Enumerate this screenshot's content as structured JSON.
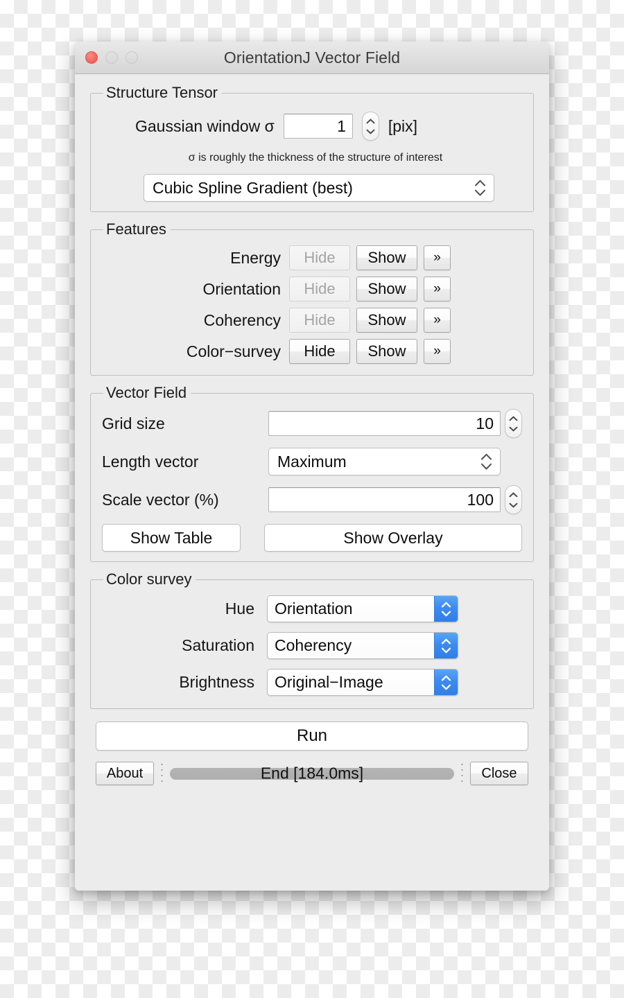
{
  "window": {
    "title": "OrientationJ Vector Field",
    "traffic_lights": [
      "close-light",
      "minimize-light",
      "zoom-light"
    ]
  },
  "structure_tensor": {
    "legend": "Structure Tensor",
    "gaussian_label": "Gaussian window σ",
    "gaussian_value": "1",
    "gaussian_unit": "[pix]",
    "hint": "σ is roughly the thickness of the structure of interest",
    "gradient_selected": "Cubic Spline Gradient (best)"
  },
  "features": {
    "legend": "Features",
    "hide_label": "Hide",
    "show_label": "Show",
    "more_label": "»",
    "rows": [
      {
        "label": "Energy",
        "hide_enabled": false
      },
      {
        "label": "Orientation",
        "hide_enabled": false
      },
      {
        "label": "Coherency",
        "hide_enabled": false
      },
      {
        "label": "Color−survey",
        "hide_enabled": true
      }
    ]
  },
  "vector_field": {
    "legend": "Vector Field",
    "grid_size_label": "Grid size",
    "grid_size_value": "10",
    "length_vector_label": "Length vector",
    "length_vector_selected": "Maximum",
    "scale_vector_label": "Scale vector (%)",
    "scale_vector_value": "100",
    "show_table_label": "Show Table",
    "show_overlay_label": "Show Overlay"
  },
  "color_survey": {
    "legend": "Color survey",
    "rows": [
      {
        "label": "Hue",
        "selected": "Orientation"
      },
      {
        "label": "Saturation",
        "selected": "Coherency"
      },
      {
        "label": "Brightness",
        "selected": "Original−Image"
      }
    ]
  },
  "bottom": {
    "run_label": "Run",
    "about_label": "About",
    "close_label": "Close",
    "status_text": "End [184.0ms]"
  },
  "colors": {
    "accent_blue": "#3d8bef",
    "close_red": "#f1675c",
    "window_bg": "#ececec",
    "progress_track": "#b0b0b0"
  }
}
